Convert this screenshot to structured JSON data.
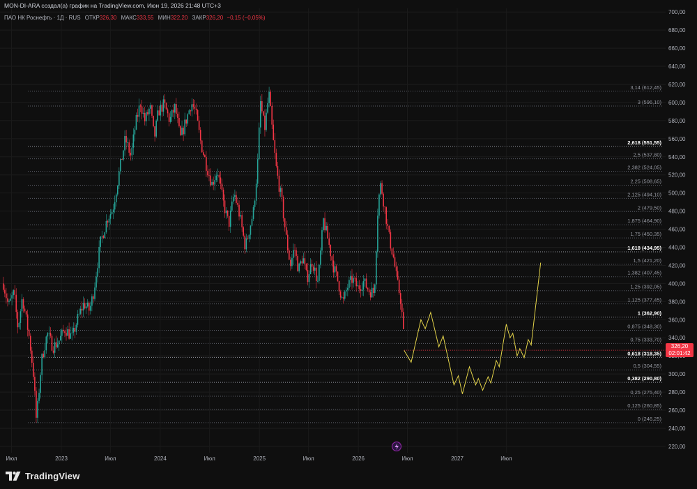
{
  "header": {
    "attribution": "MON-DI-ARA создал(а) график на TradingView.com, Июн 19, 2026 21:48 UTC+3",
    "symbol": "ПАО НК Роснефть · 1Д · RUS",
    "open_label": "ОТКР",
    "open_value": "326,30",
    "high_label": "МАКС",
    "high_value": "333,55",
    "low_label": "МИН",
    "low_value": "322,20",
    "close_label": "ЗАКР",
    "close_value": "326,20",
    "change_value": "−0,15 (−0,05%)"
  },
  "last_price": {
    "value": "326,20",
    "countdown": "02:01:42"
  },
  "brand": {
    "name": "TradingView"
  },
  "colors": {
    "up": "#26a69a",
    "down": "#f23645",
    "projection": "#e4d44a",
    "background": "#0f0f0f"
  },
  "chart_data": {
    "type": "line",
    "ylim": [
      213,
      704
    ],
    "y_ticks": [
      220,
      240,
      260,
      280,
      300,
      320,
      340,
      360,
      380,
      400,
      420,
      440,
      460,
      480,
      500,
      520,
      540,
      560,
      580,
      600,
      620,
      640,
      660,
      680,
      700
    ],
    "y_tick_labels": [
      "220,00",
      "240,00",
      "260,00",
      "280,00",
      "300,00",
      "320,00",
      "340,00",
      "360,00",
      "380,00",
      "400,00",
      "420,00",
      "440,00",
      "460,00",
      "480,00",
      "500,00",
      "520,00",
      "540,00",
      "560,00",
      "580,00",
      "600,00",
      "620,00",
      "640,00",
      "660,00",
      "680,00",
      "700,00"
    ],
    "x_ticks": [
      {
        "label": "Июл",
        "date": "2022-07-01"
      },
      {
        "label": "2023",
        "date": "2023-01-01"
      },
      {
        "label": "Июл",
        "date": "2023-07-01"
      },
      {
        "label": "2024",
        "date": "2024-01-01"
      },
      {
        "label": "Июл",
        "date": "2024-07-01"
      },
      {
        "label": "2025",
        "date": "2025-01-01"
      },
      {
        "label": "Июл",
        "date": "2025-07-01"
      },
      {
        "label": "2026",
        "date": "2026-01-01"
      },
      {
        "label": "Июл",
        "date": "2026-07-01"
      },
      {
        "label": "2027",
        "date": "2027-01-01"
      },
      {
        "label": "Июл",
        "date": "2027-07-01"
      }
    ],
    "fib_levels": [
      {
        "label": "0 (246,25)",
        "value": 246.25,
        "bold": false
      },
      {
        "label": "0,125 (260,85)",
        "value": 260.85,
        "bold": false
      },
      {
        "label": "0,25 (275,40)",
        "value": 275.4,
        "bold": false
      },
      {
        "label": "0,382 (290,80)",
        "value": 290.8,
        "bold": true
      },
      {
        "label": "0,5 (304,55)",
        "value": 304.55,
        "bold": false
      },
      {
        "label": "0,618 (318,35)",
        "value": 318.35,
        "bold": true
      },
      {
        "label": "0,75 (333,70)",
        "value": 333.7,
        "bold": false
      },
      {
        "label": "0,875 (348,30)",
        "value": 348.3,
        "bold": false
      },
      {
        "label": "1 (362,90)",
        "value": 362.9,
        "bold": true
      },
      {
        "label": "1,125 (377,45)",
        "value": 377.45,
        "bold": false
      },
      {
        "label": "1,25 (392,05)",
        "value": 392.05,
        "bold": false
      },
      {
        "label": "1,382 (407,45)",
        "value": 407.45,
        "bold": false
      },
      {
        "label": "1,5 (421,20)",
        "value": 421.2,
        "bold": false
      },
      {
        "label": "1,618 (434,95)",
        "value": 434.95,
        "bold": true
      },
      {
        "label": "1,75 (450,35)",
        "value": 450.35,
        "bold": false
      },
      {
        "label": "1,875 (464,90)",
        "value": 464.9,
        "bold": false
      },
      {
        "label": "2 (479,50)",
        "value": 479.5,
        "bold": false
      },
      {
        "label": "2,125 (494,10)",
        "value": 494.1,
        "bold": false
      },
      {
        "label": "2,25 (508,65)",
        "value": 508.65,
        "bold": false
      },
      {
        "label": "2,382 (524,05)",
        "value": 524.05,
        "bold": false
      },
      {
        "label": "2,5 (537,80)",
        "value": 537.8,
        "bold": false
      },
      {
        "label": "2,618 (551,55)",
        "value": 551.55,
        "bold": true
      },
      {
        "label": "3 (596,10)",
        "value": 596.1,
        "bold": false
      },
      {
        "label": "3,14 (612,45)",
        "value": 612.45,
        "bold": false
      }
    ],
    "price_path": [
      [
        "2022-06-01",
        400
      ],
      [
        "2022-06-20",
        375
      ],
      [
        "2022-07-10",
        390
      ],
      [
        "2022-07-25",
        350
      ],
      [
        "2022-08-10",
        385
      ],
      [
        "2022-09-05",
        340
      ],
      [
        "2022-09-20",
        300
      ],
      [
        "2022-10-01",
        248
      ],
      [
        "2022-10-20",
        315
      ],
      [
        "2022-11-10",
        345
      ],
      [
        "2022-12-01",
        330
      ],
      [
        "2022-12-20",
        335
      ],
      [
        "2023-01-15",
        350
      ],
      [
        "2023-02-10",
        340
      ],
      [
        "2023-03-01",
        360
      ],
      [
        "2023-03-25",
        378
      ],
      [
        "2023-04-15",
        370
      ],
      [
        "2023-05-01",
        392
      ],
      [
        "2023-05-25",
        445
      ],
      [
        "2023-06-20",
        472
      ],
      [
        "2023-07-10",
        482
      ],
      [
        "2023-08-01",
        520
      ],
      [
        "2023-08-25",
        560
      ],
      [
        "2023-09-15",
        540
      ],
      [
        "2023-10-01",
        575
      ],
      [
        "2023-10-20",
        600
      ],
      [
        "2023-11-05",
        580
      ],
      [
        "2023-11-25",
        595
      ],
      [
        "2023-12-10",
        560
      ],
      [
        "2023-12-25",
        590
      ],
      [
        "2024-01-15",
        598
      ],
      [
        "2024-02-05",
        580
      ],
      [
        "2024-02-25",
        595
      ],
      [
        "2024-03-15",
        560
      ],
      [
        "2024-04-05",
        580
      ],
      [
        "2024-04-25",
        600
      ],
      [
        "2024-05-10",
        590
      ],
      [
        "2024-05-30",
        555
      ],
      [
        "2024-06-20",
        530
      ],
      [
        "2024-07-10",
        510
      ],
      [
        "2024-07-30",
        525
      ],
      [
        "2024-08-20",
        490
      ],
      [
        "2024-09-10",
        465
      ],
      [
        "2024-09-30",
        500
      ],
      [
        "2024-10-20",
        475
      ],
      [
        "2024-11-10",
        440
      ],
      [
        "2024-11-25",
        460
      ],
      [
        "2024-12-10",
        480
      ],
      [
        "2024-12-25",
        530
      ],
      [
        "2025-01-05",
        600
      ],
      [
        "2025-01-20",
        570
      ],
      [
        "2025-02-05",
        610
      ],
      [
        "2025-02-20",
        560
      ],
      [
        "2025-03-05",
        525
      ],
      [
        "2025-03-25",
        490
      ],
      [
        "2025-04-10",
        450
      ],
      [
        "2025-04-25",
        420
      ],
      [
        "2025-05-10",
        440
      ],
      [
        "2025-05-25",
        415
      ],
      [
        "2025-06-10",
        430
      ],
      [
        "2025-06-25",
        405
      ],
      [
        "2025-07-15",
        425
      ],
      [
        "2025-08-05",
        400
      ],
      [
        "2025-08-25",
        470
      ],
      [
        "2025-09-10",
        450
      ],
      [
        "2025-09-30",
        420
      ],
      [
        "2025-10-20",
        400
      ],
      [
        "2025-11-05",
        378
      ],
      [
        "2025-11-20",
        395
      ],
      [
        "2025-12-10",
        405
      ],
      [
        "2025-12-30",
        395
      ],
      [
        "2026-01-20",
        402
      ],
      [
        "2026-02-10",
        392
      ],
      [
        "2026-03-01",
        390
      ],
      [
        "2026-03-15",
        490
      ],
      [
        "2026-03-25",
        510
      ],
      [
        "2026-04-10",
        480
      ],
      [
        "2026-04-25",
        450
      ],
      [
        "2026-05-10",
        430
      ],
      [
        "2026-05-25",
        400
      ],
      [
        "2026-06-05",
        385
      ],
      [
        "2026-06-15",
        355
      ],
      [
        "2026-06-19",
        326
      ]
    ],
    "projection_path": [
      [
        "2026-06-19",
        326
      ],
      [
        "2026-07-15",
        313
      ],
      [
        "2026-08-20",
        360
      ],
      [
        "2026-09-05",
        350
      ],
      [
        "2026-09-25",
        368
      ],
      [
        "2026-10-25",
        330
      ],
      [
        "2026-11-10",
        342
      ],
      [
        "2026-12-20",
        288
      ],
      [
        "2027-01-05",
        298
      ],
      [
        "2027-01-20",
        278
      ],
      [
        "2027-02-15",
        308
      ],
      [
        "2027-03-10",
        288
      ],
      [
        "2027-03-20",
        295
      ],
      [
        "2027-04-05",
        282
      ],
      [
        "2027-04-25",
        297
      ],
      [
        "2027-05-05",
        290
      ],
      [
        "2027-05-25",
        315
      ],
      [
        "2027-06-05",
        308
      ],
      [
        "2027-07-01",
        355
      ],
      [
        "2027-07-15",
        340
      ],
      [
        "2027-07-25",
        345
      ],
      [
        "2027-08-10",
        320
      ],
      [
        "2027-08-20",
        328
      ],
      [
        "2027-09-05",
        318
      ],
      [
        "2027-09-20",
        338
      ],
      [
        "2027-10-01",
        332
      ],
      [
        "2027-11-05",
        423
      ]
    ]
  }
}
